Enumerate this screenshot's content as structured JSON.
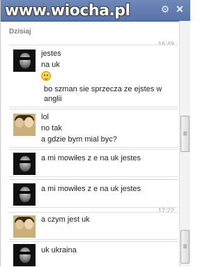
{
  "watermark": "www.wiocha.pl",
  "header": {
    "settings_icon": "gear-icon",
    "close_icon": "close-icon"
  },
  "date_label": "Dzisiaj",
  "messages": [
    {
      "time": "16:49",
      "lines": [
        "jestes",
        "na uk"
      ],
      "emoji": "smile-icon",
      "extra_lines": [
        "bo szman sie sprzecza ze ejstes  w",
        "anglii"
      ]
    },
    {
      "lines": [
        "lol",
        "no tak",
        "a gdzie bym mial byc?"
      ]
    },
    {
      "lines": [
        "a mi mowiłes z e na uk jestes"
      ]
    },
    {
      "lines": [
        "a mi mowiłes z e na uk jestes"
      ]
    },
    {
      "time": "17:22",
      "lines": [
        "a czym jest uk"
      ]
    },
    {
      "lines": [
        "uk ukraina"
      ]
    }
  ]
}
